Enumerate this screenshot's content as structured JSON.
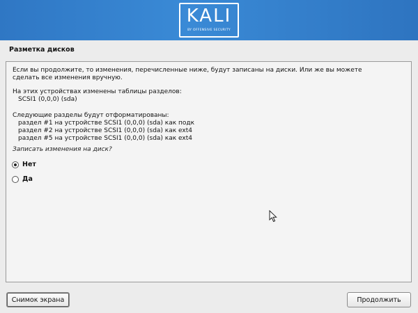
{
  "banner": {
    "logo_text": "KALI",
    "logo_subtitle": "BY OFFENSIVE SECURITY"
  },
  "section_title": "Разметка дисков",
  "content": {
    "intro_line1": "Если вы продолжите, то изменения, перечисленные ниже, будут записаны на диски. Или же вы можете",
    "intro_line2": "сделать все изменения вручную.",
    "tables_header": "На этих устройствах изменены таблицы разделов:",
    "tables_device": "SCSI1 (0,0,0) (sda)",
    "format_header": "Следующие разделы будут отформатированы:",
    "format_items": [
      "раздел #1 на устройстве SCSI1 (0,0,0) (sda) как подк",
      "раздел #2 на устройстве SCSI1 (0,0,0) (sda) как ext4",
      "раздел #5 на устройстве SCSI1 (0,0,0) (sda) как ext4"
    ],
    "question": "Записать изменения на диск?"
  },
  "options": [
    {
      "label": "Нет",
      "selected": true
    },
    {
      "label": "Да",
      "selected": false
    }
  ],
  "buttons": {
    "screenshot": "Снимок экрана",
    "continue": "Продолжить"
  },
  "colors": {
    "banner_blue": "#3a8ad6",
    "background": "#ececec"
  }
}
